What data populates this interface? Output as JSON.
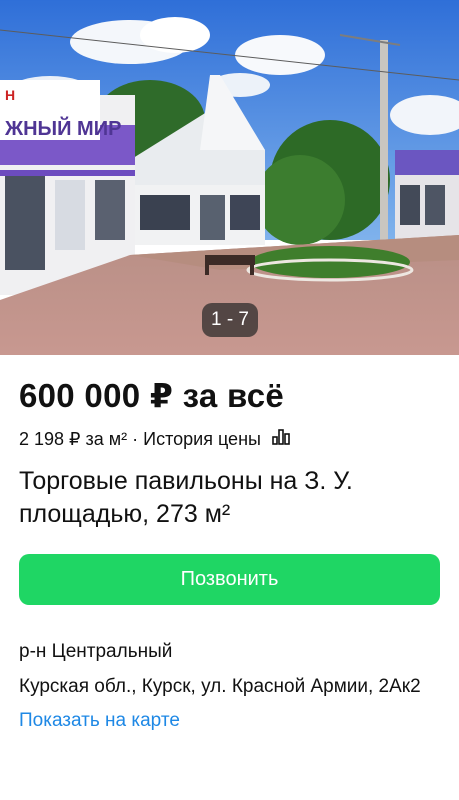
{
  "gallery": {
    "counter": "1 - 7",
    "sign_text": "ЖНЫЙ МИР",
    "sign_letter": "Н"
  },
  "listing": {
    "price": "600 000 ₽ за всё",
    "price_per_m2": "2 198 ₽ за м²",
    "separator": "·",
    "price_history": "История цены",
    "title": "Торговые павильоны на З. У. площадью, 273 м²",
    "call_label": "Позвонить",
    "district": "р-н Центральный",
    "address": "Курская обл., Курск, ул. Красной Армии, 2Ак2",
    "map_link": "Показать на карте"
  },
  "icons": {
    "price_history": "bar-chart-icon"
  },
  "colors": {
    "call_button": "#1fd664",
    "link": "#1e88e5",
    "text": "#111111"
  }
}
